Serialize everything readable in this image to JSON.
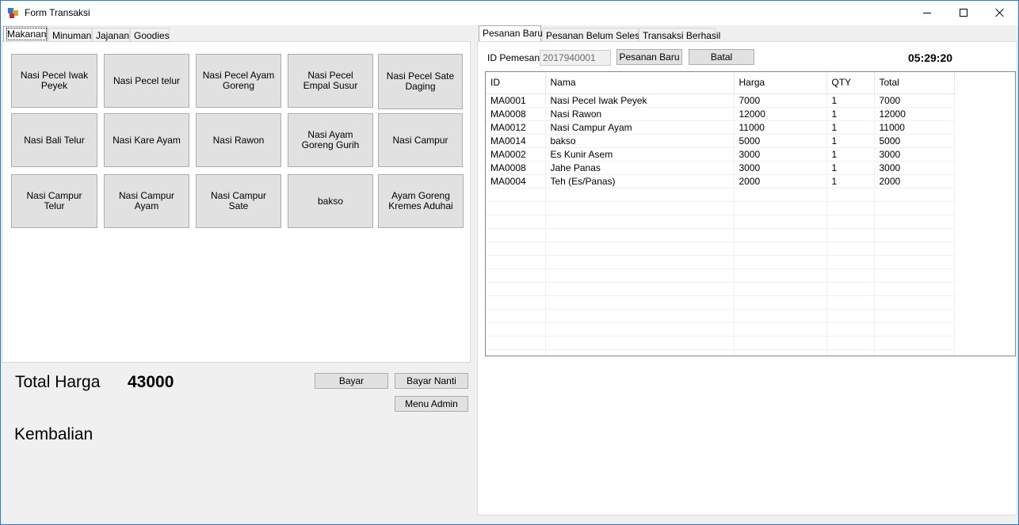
{
  "window": {
    "title": "Form Transaksi"
  },
  "left_tabs": [
    "Makanan",
    "Minuman",
    "Jajanan",
    "Goodies"
  ],
  "menu_items": [
    "Nasi Pecel Iwak Peyek",
    "Nasi Pecel telur",
    "Nasi Pecel Ayam Goreng",
    "Nasi Pecel Empal Susur",
    "Nasi Pecel Sate Daging",
    "Nasi Bali Telur",
    "Nasi Kare Ayam",
    "Nasi Rawon",
    "Nasi Ayam Goreng Gurih",
    "Nasi Campur",
    "Nasi Campur Telur",
    "Nasi Campur Ayam",
    "Nasi Campur Sate",
    "bakso",
    "Ayam Goreng Kremes Aduhai"
  ],
  "totals": {
    "total_label": "Total Harga",
    "total_value": "43000",
    "change_label": "Kembalian"
  },
  "actions": {
    "pay": "Bayar",
    "pay_later": "Bayar Nanti",
    "admin": "Menu Admin"
  },
  "right_tabs": [
    "Pesanan Baru",
    "Pesanan Belum Selesai",
    "Transaksi Berhasil"
  ],
  "order": {
    "id_label": "ID Pemesan",
    "id_value": "2017940001",
    "new_button": "Pesanan Baru",
    "cancel_button": "Batal",
    "clock": "05:29:20"
  },
  "table": {
    "columns": [
      "ID",
      "Nama",
      "Harga",
      "QTY",
      "Total"
    ],
    "rows": [
      [
        "MA0001",
        "Nasi Pecel Iwak Peyek",
        "7000",
        "1",
        "7000"
      ],
      [
        "MA0008",
        "Nasi Rawon",
        "12000",
        "1",
        "12000"
      ],
      [
        "MA0012",
        "Nasi Campur Ayam",
        "11000",
        "1",
        "11000"
      ],
      [
        "MA0014",
        "bakso",
        "5000",
        "1",
        "5000"
      ],
      [
        "MA0002",
        "Es Kunir Asem",
        "3000",
        "1",
        "3000"
      ],
      [
        "MA0008",
        "Jahe Panas",
        "3000",
        "1",
        "3000"
      ],
      [
        "MA0004",
        "Teh (Es/Panas)",
        "2000",
        "1",
        "2000"
      ]
    ]
  }
}
